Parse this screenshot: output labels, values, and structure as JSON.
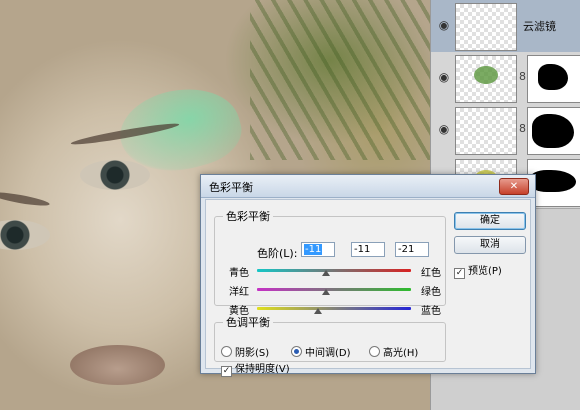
{
  "layers": [
    {
      "name": "云滤镜",
      "active": true
    },
    {
      "name": ""
    },
    {
      "name": ""
    },
    {
      "name": ""
    }
  ],
  "dialog": {
    "title": "色彩平衡",
    "close_glyph": "✕",
    "color_balance": {
      "legend": "色彩平衡",
      "levels_label": "色阶(L):",
      "levels": [
        "-11",
        "-11",
        "-21"
      ],
      "sliders": [
        {
          "left": "青色",
          "right": "红色",
          "value": -11
        },
        {
          "left": "洋红",
          "right": "绿色",
          "value": -11
        },
        {
          "left": "黄色",
          "right": "蓝色",
          "value": -21
        }
      ]
    },
    "tone_balance": {
      "legend": "色调平衡",
      "options": [
        "阴影(S)",
        "中间调(D)",
        "高光(H)"
      ],
      "selected": "中间调(D)",
      "preserve_luminosity": "保持明度(V)",
      "preserve_checked": true
    },
    "ok_label": "确定",
    "cancel_label": "取消",
    "preview_label": "预览(P)",
    "preview_checked": true
  },
  "colors": {
    "cyan": "#16c6c6",
    "red": "#d82222",
    "magenta": "#c531c5",
    "green": "#2ebc2e",
    "yellow": "#e0e01e",
    "blue": "#2525d6"
  }
}
